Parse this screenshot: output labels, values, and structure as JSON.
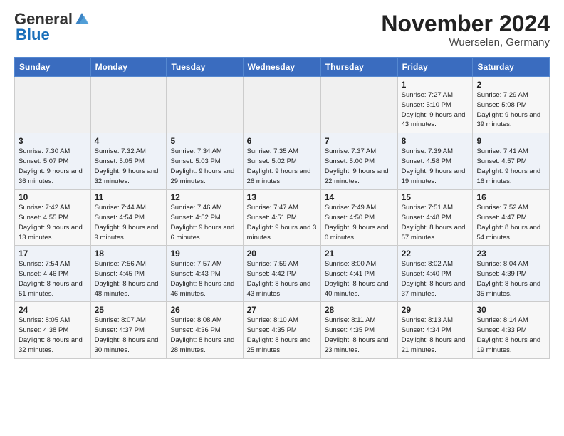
{
  "header": {
    "logo_general": "General",
    "logo_blue": "Blue",
    "month": "November 2024",
    "location": "Wuerselen, Germany"
  },
  "days_of_week": [
    "Sunday",
    "Monday",
    "Tuesday",
    "Wednesday",
    "Thursday",
    "Friday",
    "Saturday"
  ],
  "weeks": [
    [
      {
        "day": "",
        "info": ""
      },
      {
        "day": "",
        "info": ""
      },
      {
        "day": "",
        "info": ""
      },
      {
        "day": "",
        "info": ""
      },
      {
        "day": "",
        "info": ""
      },
      {
        "day": "1",
        "info": "Sunrise: 7:27 AM\nSunset: 5:10 PM\nDaylight: 9 hours and 43 minutes."
      },
      {
        "day": "2",
        "info": "Sunrise: 7:29 AM\nSunset: 5:08 PM\nDaylight: 9 hours and 39 minutes."
      }
    ],
    [
      {
        "day": "3",
        "info": "Sunrise: 7:30 AM\nSunset: 5:07 PM\nDaylight: 9 hours and 36 minutes."
      },
      {
        "day": "4",
        "info": "Sunrise: 7:32 AM\nSunset: 5:05 PM\nDaylight: 9 hours and 32 minutes."
      },
      {
        "day": "5",
        "info": "Sunrise: 7:34 AM\nSunset: 5:03 PM\nDaylight: 9 hours and 29 minutes."
      },
      {
        "day": "6",
        "info": "Sunrise: 7:35 AM\nSunset: 5:02 PM\nDaylight: 9 hours and 26 minutes."
      },
      {
        "day": "7",
        "info": "Sunrise: 7:37 AM\nSunset: 5:00 PM\nDaylight: 9 hours and 22 minutes."
      },
      {
        "day": "8",
        "info": "Sunrise: 7:39 AM\nSunset: 4:58 PM\nDaylight: 9 hours and 19 minutes."
      },
      {
        "day": "9",
        "info": "Sunrise: 7:41 AM\nSunset: 4:57 PM\nDaylight: 9 hours and 16 minutes."
      }
    ],
    [
      {
        "day": "10",
        "info": "Sunrise: 7:42 AM\nSunset: 4:55 PM\nDaylight: 9 hours and 13 minutes."
      },
      {
        "day": "11",
        "info": "Sunrise: 7:44 AM\nSunset: 4:54 PM\nDaylight: 9 hours and 9 minutes."
      },
      {
        "day": "12",
        "info": "Sunrise: 7:46 AM\nSunset: 4:52 PM\nDaylight: 9 hours and 6 minutes."
      },
      {
        "day": "13",
        "info": "Sunrise: 7:47 AM\nSunset: 4:51 PM\nDaylight: 9 hours and 3 minutes."
      },
      {
        "day": "14",
        "info": "Sunrise: 7:49 AM\nSunset: 4:50 PM\nDaylight: 9 hours and 0 minutes."
      },
      {
        "day": "15",
        "info": "Sunrise: 7:51 AM\nSunset: 4:48 PM\nDaylight: 8 hours and 57 minutes."
      },
      {
        "day": "16",
        "info": "Sunrise: 7:52 AM\nSunset: 4:47 PM\nDaylight: 8 hours and 54 minutes."
      }
    ],
    [
      {
        "day": "17",
        "info": "Sunrise: 7:54 AM\nSunset: 4:46 PM\nDaylight: 8 hours and 51 minutes."
      },
      {
        "day": "18",
        "info": "Sunrise: 7:56 AM\nSunset: 4:45 PM\nDaylight: 8 hours and 48 minutes."
      },
      {
        "day": "19",
        "info": "Sunrise: 7:57 AM\nSunset: 4:43 PM\nDaylight: 8 hours and 46 minutes."
      },
      {
        "day": "20",
        "info": "Sunrise: 7:59 AM\nSunset: 4:42 PM\nDaylight: 8 hours and 43 minutes."
      },
      {
        "day": "21",
        "info": "Sunrise: 8:00 AM\nSunset: 4:41 PM\nDaylight: 8 hours and 40 minutes."
      },
      {
        "day": "22",
        "info": "Sunrise: 8:02 AM\nSunset: 4:40 PM\nDaylight: 8 hours and 37 minutes."
      },
      {
        "day": "23",
        "info": "Sunrise: 8:04 AM\nSunset: 4:39 PM\nDaylight: 8 hours and 35 minutes."
      }
    ],
    [
      {
        "day": "24",
        "info": "Sunrise: 8:05 AM\nSunset: 4:38 PM\nDaylight: 8 hours and 32 minutes."
      },
      {
        "day": "25",
        "info": "Sunrise: 8:07 AM\nSunset: 4:37 PM\nDaylight: 8 hours and 30 minutes."
      },
      {
        "day": "26",
        "info": "Sunrise: 8:08 AM\nSunset: 4:36 PM\nDaylight: 8 hours and 28 minutes."
      },
      {
        "day": "27",
        "info": "Sunrise: 8:10 AM\nSunset: 4:35 PM\nDaylight: 8 hours and 25 minutes."
      },
      {
        "day": "28",
        "info": "Sunrise: 8:11 AM\nSunset: 4:35 PM\nDaylight: 8 hours and 23 minutes."
      },
      {
        "day": "29",
        "info": "Sunrise: 8:13 AM\nSunset: 4:34 PM\nDaylight: 8 hours and 21 minutes."
      },
      {
        "day": "30",
        "info": "Sunrise: 8:14 AM\nSunset: 4:33 PM\nDaylight: 8 hours and 19 minutes."
      }
    ]
  ]
}
